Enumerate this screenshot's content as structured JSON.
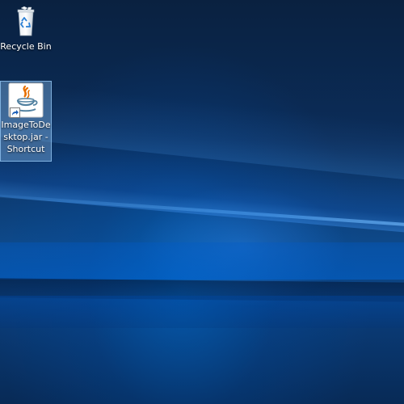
{
  "desktop": {
    "icons": [
      {
        "label": "Recycle Bin",
        "icon": "recycle-bin-icon"
      },
      {
        "label": "ImageToDesktop.jar - Shortcut",
        "icon": "java-icon",
        "selected": true
      }
    ]
  },
  "colors": {
    "wallpaper_dark": "#0a2140",
    "wallpaper_blue": "#0e4b8d",
    "selection": "#78aadc",
    "java_orange": "#e76f00",
    "java_blue": "#5382a1"
  }
}
